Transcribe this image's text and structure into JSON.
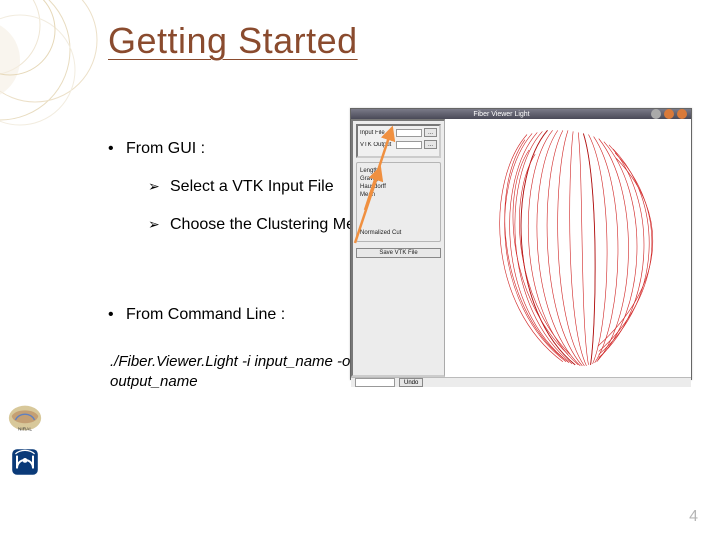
{
  "title": "Getting Started",
  "content": {
    "gui_heading": "From GUI :",
    "gui_step1": "Select a VTK Input File",
    "gui_step2": "Choose the Clustering Method",
    "cmd_heading": "From Command Line :",
    "cmd_text": "./Fiber.Viewer.Light -i input_name -o output_name"
  },
  "slide_number": "4",
  "screenshot": {
    "window_title": "Fiber Viewer Light",
    "input_label": "Input File",
    "browse": "...",
    "vtk_label": "VTK Output",
    "method_box": [
      "Length",
      "Gravity",
      "Hausdorff",
      "Mean"
    ],
    "method_last": "Normalized Cut",
    "save_btn": "Save VTK File",
    "status_btn": "Undo"
  },
  "colors": {
    "accent": "#8a4b2e",
    "arrow": "#f09040"
  }
}
